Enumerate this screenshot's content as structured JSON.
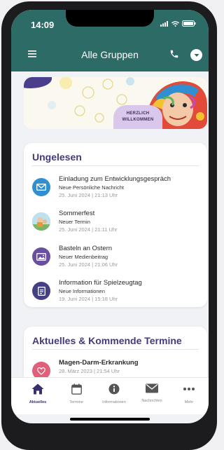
{
  "status": {
    "time": "14:09"
  },
  "header": {
    "title": "Alle Gruppen"
  },
  "banner": {
    "line1": "HERZLICH",
    "line2": "WILLKOMMEN"
  },
  "unread": {
    "title": "Ungelesen",
    "items": [
      {
        "title": "Einladung zum Entwicklungsgespräch",
        "sub": "Neue Persönliche Nachricht",
        "date": "25. Juni 2024 | 21:13 Uhr",
        "icon": "mail-icon",
        "color": "#2f8fd0"
      },
      {
        "title": "Sommerfest",
        "sub": "Neuer Termin",
        "date": "25. Juni 2024 | 21:11 Uhr",
        "icon": "event-photo-icon",
        "color": "#6aa0b8"
      },
      {
        "title": "Basteln an Ostern",
        "sub": "Neuer Medienbeitrag",
        "date": "25. Juni 2024 | 21:06 Uhr",
        "icon": "image-icon",
        "color": "#6a4fa0"
      },
      {
        "title": "Information für Spielzeugtag",
        "sub": "Neue Informationen",
        "date": "19. Juni 2024 | 15:18 Uhr",
        "icon": "document-icon",
        "color": "#453f86"
      }
    ]
  },
  "news": {
    "title": "Aktuelles & Kommende Termine",
    "items": [
      {
        "title": "Magen-Darm-Erkrankung",
        "date": "28. März 2023 | 21:54 Uhr",
        "icon": "heart-icon",
        "color": "#e0607a"
      }
    ]
  },
  "tabs": [
    {
      "label": "Aktuelles",
      "icon": "home-icon"
    },
    {
      "label": "Termine",
      "icon": "calendar-icon"
    },
    {
      "label": "Informationen",
      "icon": "info-icon"
    },
    {
      "label": "Nachrichten",
      "icon": "envelope-icon"
    },
    {
      "label": "Mehr",
      "icon": "more-icon"
    }
  ]
}
